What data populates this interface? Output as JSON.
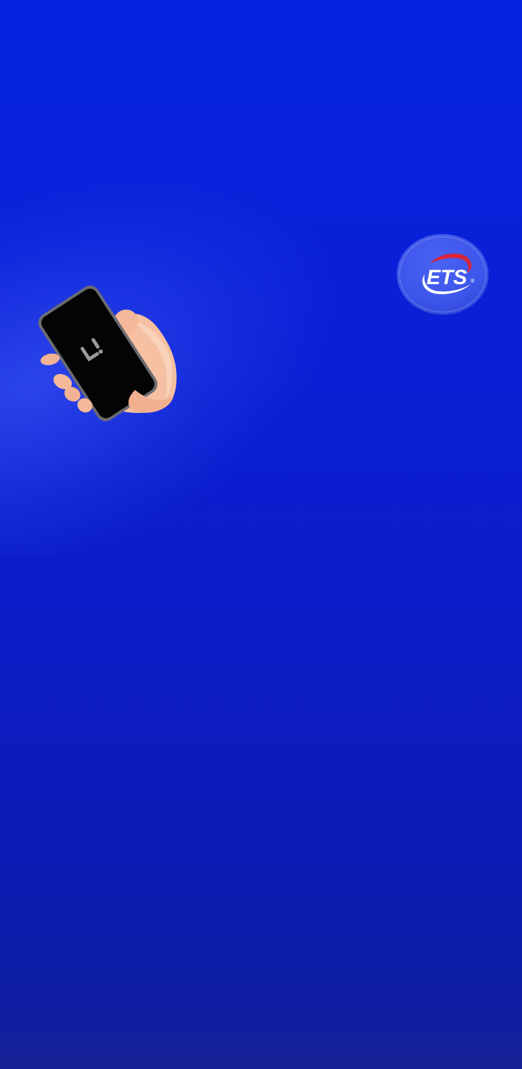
{
  "splash": {
    "background_color_top": "#0624e0",
    "background_color_bottom": "#11209c",
    "phone_logo_icon": "app-logo-icon",
    "badge": {
      "text": "ETS",
      "registered_mark": "®",
      "icon": "ets-logo-icon",
      "arc_color": "#d8253a"
    }
  }
}
